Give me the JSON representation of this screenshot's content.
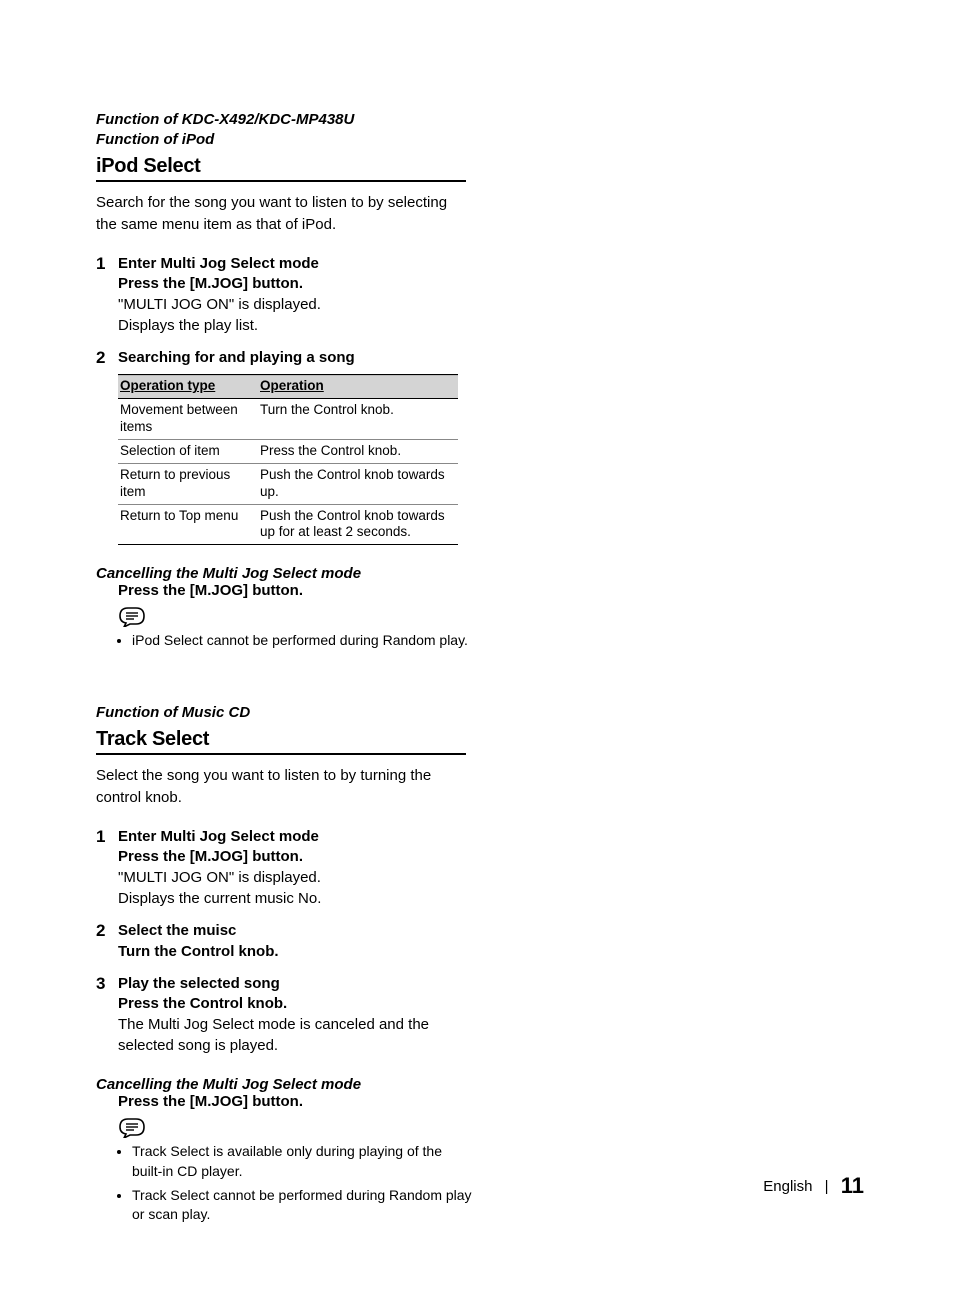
{
  "s1": {
    "func1": "Function of KDC-X492/KDC-MP438U",
    "func2": "Function of iPod",
    "title": "iPod Select",
    "intro": "Search for the song you want to listen to by selecting the same menu item as that of iPod.",
    "step1": {
      "num": "1",
      "head": "Enter Multi Jog Select mode",
      "sub": "Press the [M.JOG] button.",
      "line1": "\"MULTI JOG ON\" is displayed.",
      "line2": "Displays the play list."
    },
    "step2": {
      "num": "2",
      "head": "Searching for and playing a song",
      "th1": "Operation type",
      "th2": "Operation",
      "rows": [
        {
          "a": "Movement between items",
          "b": "Turn the Control knob."
        },
        {
          "a": "Selection of item",
          "b": "Press the Control knob."
        },
        {
          "a": "Return to previous item",
          "b": "Push the Control knob towards up."
        },
        {
          "a": "Return to Top menu",
          "b": "Push the Control knob towards up for at least 2 seconds."
        }
      ]
    },
    "cancel": {
      "head": "Cancelling the Multi Jog Select mode",
      "sub": "Press the [M.JOG] button.",
      "note1": "iPod Select cannot be performed during Random play."
    }
  },
  "s2": {
    "func1": "Function of Music CD",
    "title": "Track Select",
    "intro": "Select the song you want to listen to by turning the control knob.",
    "step1": {
      "num": "1",
      "head": "Enter Multi Jog Select mode",
      "sub": "Press the [M.JOG] button.",
      "line1": "\"MULTI JOG ON\" is displayed.",
      "line2": "Displays the current music No."
    },
    "step2": {
      "num": "2",
      "head": "Select the muisc",
      "sub": "Turn the Control knob."
    },
    "step3": {
      "num": "3",
      "head": "Play the selected song",
      "sub": "Press the Control knob.",
      "line1": "The Multi Jog Select mode is canceled and the selected song is played."
    },
    "cancel": {
      "head": "Cancelling the Multi Jog Select mode",
      "sub": "Press the [M.JOG] button.",
      "note1": "Track Select is available only during playing of the built-in CD player.",
      "note2": "Track Select cannot be performed during Random play or scan play."
    }
  },
  "footer": {
    "lang": "English",
    "sep": "|",
    "page": "11"
  }
}
